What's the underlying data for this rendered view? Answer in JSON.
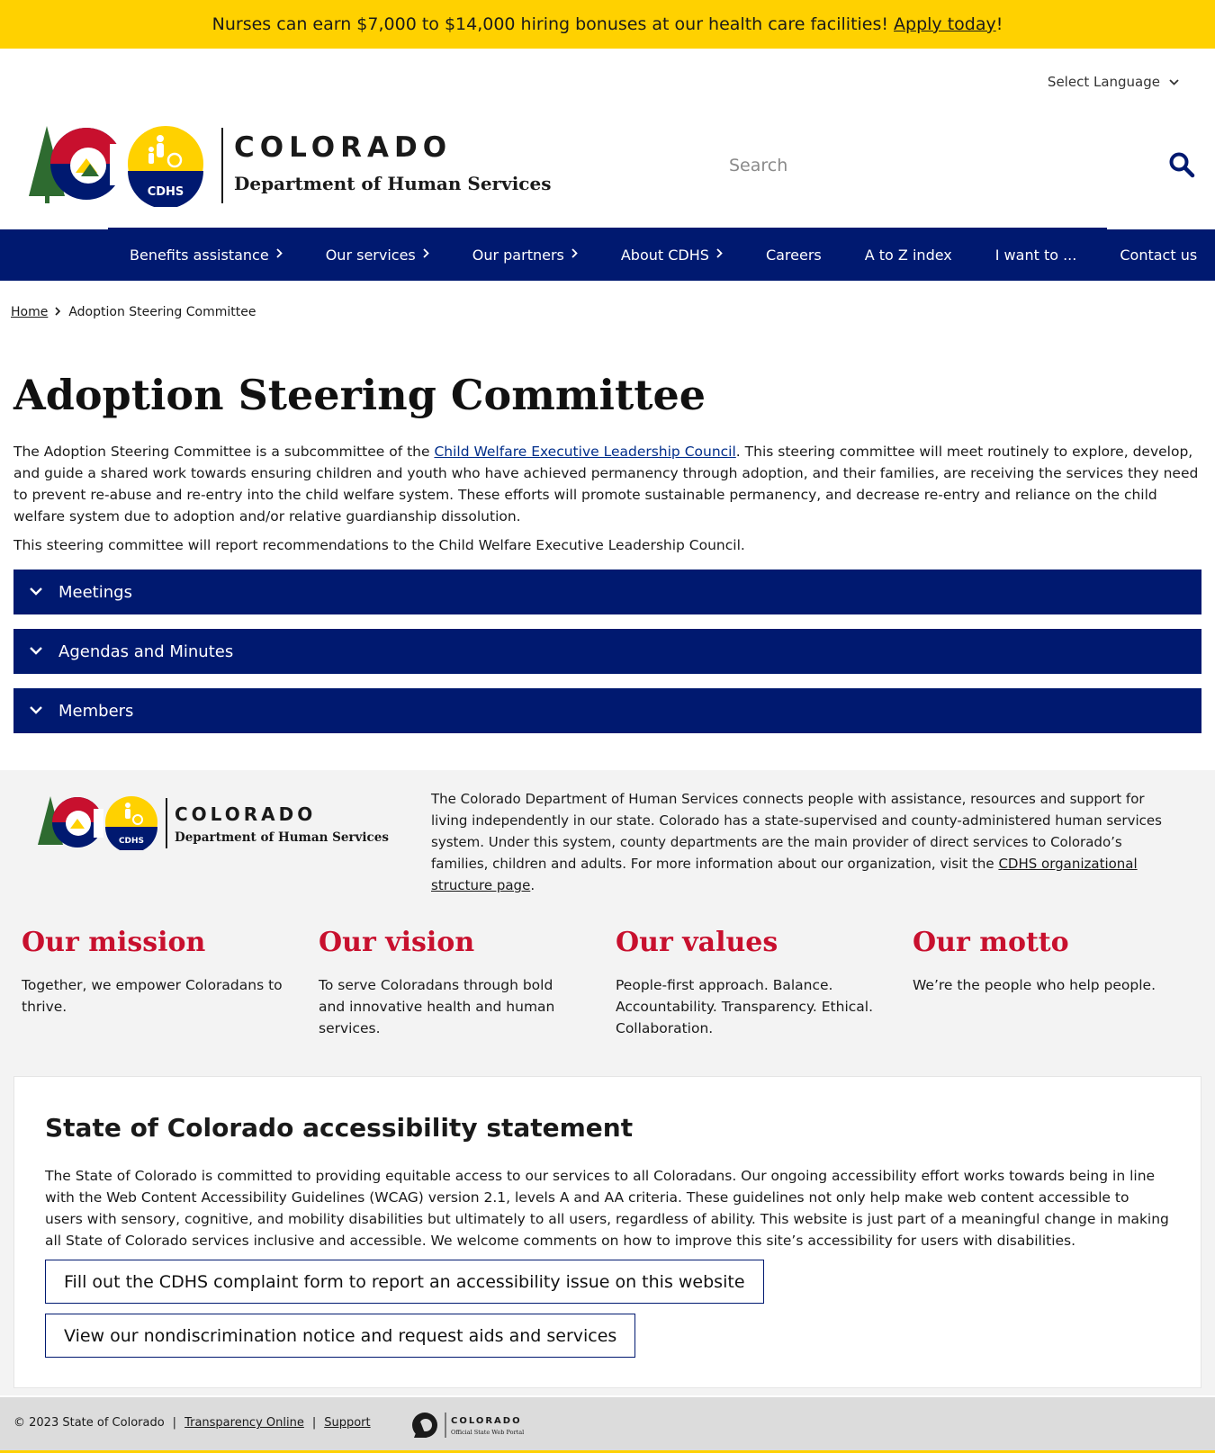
{
  "banner": {
    "text": "Nurses can earn $7,000 to $14,000 hiring bonuses at our health care facilities!",
    "link_label": "Apply today",
    "after": "!"
  },
  "language": {
    "label": "Select Language"
  },
  "logo": {
    "title": "COLORADO",
    "subtitle": "Department of Human Services",
    "badge": "CDHS"
  },
  "search": {
    "placeholder": "Search"
  },
  "nav": {
    "items": [
      {
        "label": "Benefits assistance",
        "has_submenu": true
      },
      {
        "label": "Our services",
        "has_submenu": true
      },
      {
        "label": "Our partners",
        "has_submenu": true
      },
      {
        "label": "About CDHS",
        "has_submenu": true
      },
      {
        "label": "Careers",
        "has_submenu": false
      },
      {
        "label": "A to Z index",
        "has_submenu": false
      },
      {
        "label": "I want to ...",
        "has_submenu": false
      },
      {
        "label": "Contact us",
        "has_submenu": false
      }
    ]
  },
  "breadcrumb": {
    "home": "Home",
    "current": "Adoption Steering Committee"
  },
  "page": {
    "title": "Adoption Steering Committee",
    "intro_before": "The Adoption Steering Committee is a subcommittee of the ",
    "intro_link": "Child Welfare Executive Leadership Council",
    "intro_after": ". This steering committee will meet routinely to explore, develop, and guide a shared work towards ensuring children and youth who have achieved permanency through adoption, and their families, are receiving the services they need to prevent re-abuse and re-entry into the child welfare system. These efforts will promote sustainable permanency, and decrease re-entry and reliance on the child welfare system due to adoption and/or relative guardianship dissolution.",
    "intro2": "This steering committee will report recommendations to the Child Welfare Executive Leadership Council.",
    "accordions": [
      "Meetings",
      "Agendas and Minutes",
      "Members"
    ]
  },
  "footer": {
    "logo_title": "COLORADO",
    "logo_subtitle": "Department of Human Services",
    "logo_badge": "CDHS",
    "description_before": "The Colorado Department of Human Services connects people with assistance, resources and support for living independently in our state. Colorado has a state-supervised and county-administered human services system. Under this system, county departments are the main provider of direct services to Colorado’s families, children and adults. For more information about our organization, visit the ",
    "description_link": "CDHS organizational structure page",
    "description_after": ".",
    "pillars": [
      {
        "title": "Our mission",
        "text": "Together, we empower Coloradans to thrive."
      },
      {
        "title": "Our vision",
        "text": "To serve Coloradans through bold and innovative health and human services."
      },
      {
        "title": "Our values",
        "text": "People-first approach. Balance. Accountability. Transparency. Ethical. Collaboration."
      },
      {
        "title": "Our motto",
        "text": "We’re the people who help people."
      }
    ]
  },
  "accessibility": {
    "title": "State of Colorado accessibility statement",
    "text": "The State of Colorado is committed to providing equitable access to our services to all Coloradans. Our ongoing accessibility effort works towards being in line with the Web Content Accessibility Guidelines (WCAG) version 2.1, levels A and AA criteria. These guidelines not only help make web content accessible to users with sensory, cognitive, and mobility disabilities but ultimately to all users, regardless of ability. This website is just part of a meaningful change in making all State of Colorado services inclusive and accessible. We welcome comments on how to improve this site’s accessibility for users with disabilities.",
    "button1": "Fill out the CDHS complaint form to report an accessibility issue on this website",
    "button2": "View our nondiscrimination notice and request aids and services"
  },
  "bottom": {
    "copyright": "© 2023 State of Colorado",
    "sep": "|",
    "link1": "Transparency Online",
    "link2": "Support",
    "portal_title": "COLORADO",
    "portal_sub": "Official State Web Portal"
  },
  "colors": {
    "navy": "#001970",
    "gold": "#ffd100",
    "red": "#c8102e",
    "footer_gray": "#f3f3f3"
  }
}
